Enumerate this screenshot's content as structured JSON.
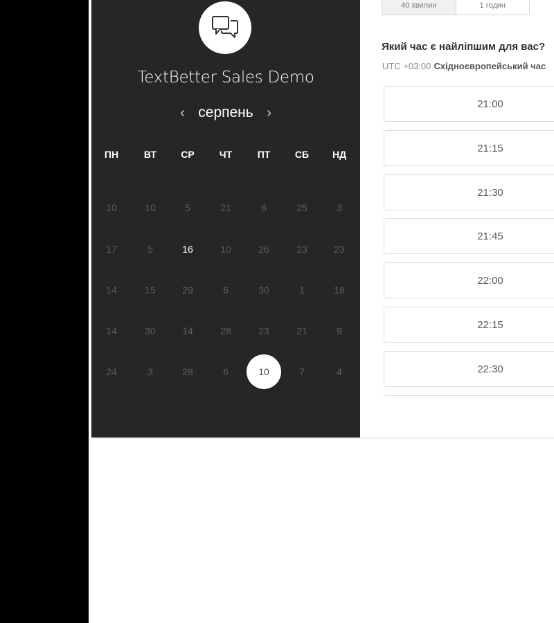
{
  "company": {
    "name": "TextBetter Sales Demo",
    "icon": "chat-bubbles-icon"
  },
  "calendar": {
    "month": "серпень",
    "prev_icon": "chevron-left-icon",
    "next_icon": "chevron-right-icon",
    "weekdays": [
      "ПН",
      "ВТ",
      "СР",
      "ЧТ",
      "ПТ",
      "СБ",
      "НД"
    ],
    "weeks": [
      [
        "10",
        "10",
        "5",
        "21",
        "6",
        "25",
        "3"
      ],
      [
        "17",
        "5",
        "16",
        "10",
        "26",
        "23",
        "23"
      ],
      [
        "14",
        "15",
        "29",
        "6",
        "30",
        "1",
        "18"
      ],
      [
        "14",
        "30",
        "14",
        "28",
        "23",
        "21",
        "9"
      ],
      [
        "24",
        "3",
        "28",
        "6",
        "10",
        "7",
        "4"
      ]
    ],
    "available_day": "16",
    "selected_day": "10"
  },
  "durations": [
    "40 хвилин",
    "1 годин"
  ],
  "question": "Який час є найліпшим для вас?",
  "timezone": {
    "offset": "UTC +03:00",
    "name": "Східноєвропейський час"
  },
  "time_slots": [
    "21:00",
    "21:15",
    "21:30",
    "21:45",
    "22:00",
    "22:15",
    "22:30",
    ""
  ],
  "colors": {
    "panel": "#262626",
    "page": "#ffffff",
    "left_bar": "#000000"
  }
}
